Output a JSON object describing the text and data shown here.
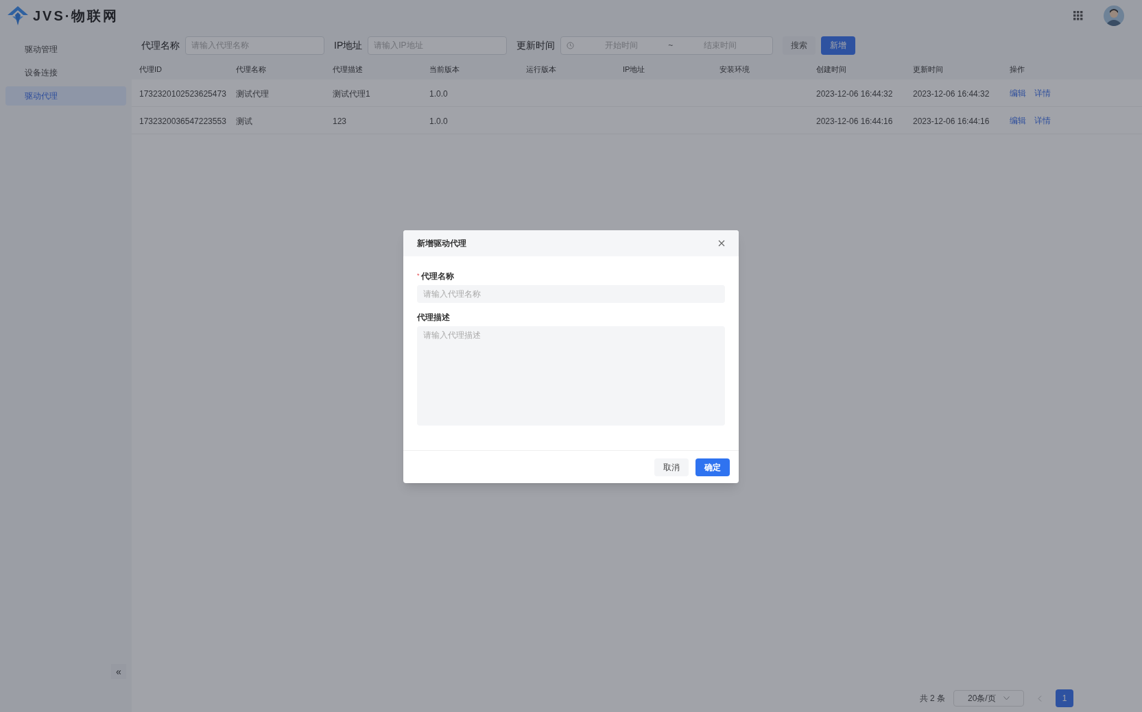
{
  "header": {
    "logo_text": "JVS·物联网"
  },
  "sidebar": {
    "items": [
      {
        "label": "驱动管理",
        "selected": false
      },
      {
        "label": "设备连接",
        "selected": false
      },
      {
        "label": "驱动代理",
        "selected": true
      }
    ],
    "collapse": "«"
  },
  "filters": [
    {
      "label": "代理名称",
      "placeholder": "请输入代理名称"
    },
    {
      "label": "IP地址",
      "placeholder": "请输入IP地址"
    }
  ],
  "date_filter": {
    "label": "更新时间",
    "start_placeholder": "开始时间",
    "separator": "~",
    "end_placeholder": "结束时间"
  },
  "buttons": {
    "search": "搜索",
    "add": "新增"
  },
  "table": {
    "columns": [
      "代理ID",
      "代理名称",
      "代理描述",
      "当前版本",
      "运行版本",
      "IP地址",
      "安装环境",
      "创建时间",
      "更新时间",
      "操作"
    ],
    "rows": [
      {
        "cells": [
          "1732320102523625473",
          "测试代理",
          "测试代理1",
          "1.0.0",
          "",
          "",
          "",
          "2023-12-06 16:44:32",
          "2023-12-06 16:44:32"
        ],
        "actions": [
          "编辑",
          "详情"
        ]
      },
      {
        "cells": [
          "1732320036547223553",
          "测试",
          "123",
          "1.0.0",
          "",
          "",
          "",
          "2023-12-06 16:44:16",
          "2023-12-06 16:44:16"
        ],
        "actions": [
          "编辑",
          "详情"
        ]
      }
    ]
  },
  "pagination": {
    "total": "共 2 条",
    "page_size": "20条/页",
    "pages": [
      {
        "label": "1",
        "selected": true
      }
    ]
  },
  "dialog": {
    "title": "新增驱动代理",
    "fields": [
      {
        "label": "代理名称",
        "required_mark": "*",
        "kind": "input",
        "placeholder": "请输入代理名称"
      },
      {
        "label": "代理描述",
        "kind": "textarea",
        "placeholder": "请输入代理描述"
      }
    ],
    "cancel": "取消",
    "confirm": "确定"
  }
}
